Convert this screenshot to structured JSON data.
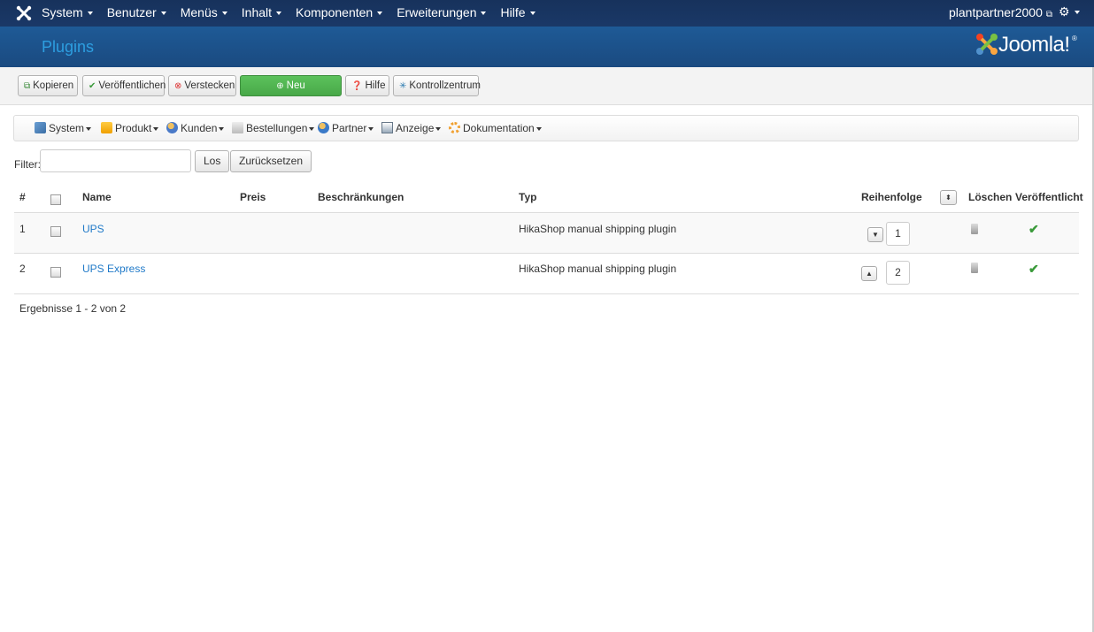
{
  "topnav": {
    "menu": [
      {
        "label": "System"
      },
      {
        "label": "Benutzer"
      },
      {
        "label": "Menüs"
      },
      {
        "label": "Inhalt"
      },
      {
        "label": "Komponenten"
      },
      {
        "label": "Erweiterungen"
      },
      {
        "label": "Hilfe"
      }
    ],
    "user": "plantpartner2000"
  },
  "header": {
    "title": "Plugins",
    "logo_text": "Joomla!",
    "logo_reg": "®"
  },
  "toolbar": {
    "copy": "Kopieren",
    "publish": "Veröffentlichen",
    "hide": "Verstecken",
    "new": "Neu",
    "help": "Hilfe",
    "control": "Kontrollzentrum"
  },
  "submenu": {
    "system": "System",
    "product": "Produkt",
    "customers": "Kunden",
    "orders": "Bestellungen",
    "partner": "Partner",
    "display": "Anzeige",
    "docs": "Dokumentation"
  },
  "filter": {
    "label": "Filter:",
    "value": "",
    "go": "Los",
    "reset": "Zurücksetzen"
  },
  "table": {
    "headers": {
      "num": "#",
      "name": "Name",
      "price": "Preis",
      "restrictions": "Beschränkungen",
      "type": "Typ",
      "ordering": "Reihenfolge",
      "delete": "Löschen",
      "published": "Veröffentlicht"
    },
    "rows": [
      {
        "num": "1",
        "name": "UPS",
        "price": "",
        "restrictions": "",
        "type": "HikaShop manual shipping plugin",
        "order": "1",
        "published": true
      },
      {
        "num": "2",
        "name": "UPS Express",
        "price": "",
        "restrictions": "",
        "type": "HikaShop manual shipping plugin",
        "order": "2",
        "published": true
      }
    ]
  },
  "results": "Ergebnisse 1 - 2 von 2",
  "colors": {
    "navbar": "#1a3867",
    "header": "#1c5089",
    "accent": "#2d9ee0",
    "new_button": "#51b551",
    "link": "#1f79c8",
    "check": "#3a9a3a"
  }
}
